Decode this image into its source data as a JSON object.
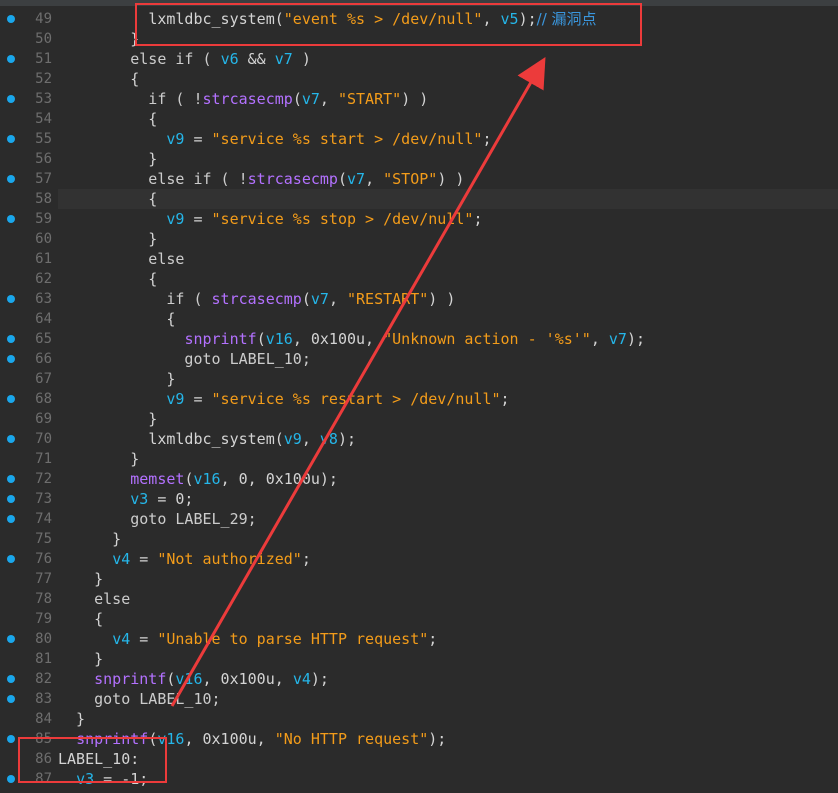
{
  "editor": {
    "lines": [
      {
        "n": "49",
        "bp": true,
        "tokens": [
          {
            "t": "          ",
            "c": "p"
          },
          {
            "t": "lxmldbc_system",
            "c": "id"
          },
          {
            "t": "(",
            "c": "p"
          },
          {
            "t": "\"event %s > /dev/null\"",
            "c": "str"
          },
          {
            "t": ", ",
            "c": "p"
          },
          {
            "t": "v5",
            "c": "var"
          },
          {
            "t": ");",
            "c": "p"
          },
          {
            "t": "// 漏洞点",
            "c": "cm"
          }
        ]
      },
      {
        "n": "50",
        "bp": false,
        "tokens": [
          {
            "t": "        }",
            "c": "p"
          }
        ]
      },
      {
        "n": "51",
        "bp": true,
        "tokens": [
          {
            "t": "        else if ( ",
            "c": "kw"
          },
          {
            "t": "v6",
            "c": "var"
          },
          {
            "t": " && ",
            "c": "p"
          },
          {
            "t": "v7",
            "c": "var"
          },
          {
            "t": " )",
            "c": "p"
          }
        ]
      },
      {
        "n": "52",
        "bp": false,
        "tokens": [
          {
            "t": "        {",
            "c": "p"
          }
        ]
      },
      {
        "n": "53",
        "bp": true,
        "tokens": [
          {
            "t": "          if ( !",
            "c": "kw"
          },
          {
            "t": "strcasecmp",
            "c": "fn"
          },
          {
            "t": "(",
            "c": "p"
          },
          {
            "t": "v7",
            "c": "var"
          },
          {
            "t": ", ",
            "c": "p"
          },
          {
            "t": "\"START\"",
            "c": "str"
          },
          {
            "t": ") )",
            "c": "p"
          }
        ]
      },
      {
        "n": "54",
        "bp": false,
        "tokens": [
          {
            "t": "          {",
            "c": "p"
          }
        ]
      },
      {
        "n": "55",
        "bp": true,
        "tokens": [
          {
            "t": "            ",
            "c": "p"
          },
          {
            "t": "v9",
            "c": "var"
          },
          {
            "t": " = ",
            "c": "p"
          },
          {
            "t": "\"service %s start > /dev/null\"",
            "c": "str"
          },
          {
            "t": ";",
            "c": "p"
          }
        ]
      },
      {
        "n": "56",
        "bp": false,
        "tokens": [
          {
            "t": "          }",
            "c": "p"
          }
        ]
      },
      {
        "n": "57",
        "bp": true,
        "tokens": [
          {
            "t": "          else if ( !",
            "c": "kw"
          },
          {
            "t": "strcasecmp",
            "c": "fn"
          },
          {
            "t": "(",
            "c": "p"
          },
          {
            "t": "v7",
            "c": "var"
          },
          {
            "t": ", ",
            "c": "p"
          },
          {
            "t": "\"STOP\"",
            "c": "str"
          },
          {
            "t": ") )",
            "c": "p"
          }
        ]
      },
      {
        "n": "58",
        "bp": false,
        "hl": true,
        "tokens": [
          {
            "t": "          {",
            "c": "p"
          }
        ]
      },
      {
        "n": "59",
        "bp": true,
        "tokens": [
          {
            "t": "            ",
            "c": "p"
          },
          {
            "t": "v9",
            "c": "var"
          },
          {
            "t": " = ",
            "c": "p"
          },
          {
            "t": "\"service %s stop > /dev/null\"",
            "c": "str"
          },
          {
            "t": ";",
            "c": "p"
          }
        ]
      },
      {
        "n": "60",
        "bp": false,
        "tokens": [
          {
            "t": "          }",
            "c": "p"
          }
        ]
      },
      {
        "n": "61",
        "bp": false,
        "tokens": [
          {
            "t": "          else",
            "c": "kw"
          }
        ]
      },
      {
        "n": "62",
        "bp": false,
        "tokens": [
          {
            "t": "          {",
            "c": "p"
          }
        ]
      },
      {
        "n": "63",
        "bp": true,
        "tokens": [
          {
            "t": "            if ( ",
            "c": "kw"
          },
          {
            "t": "strcasecmp",
            "c": "fn"
          },
          {
            "t": "(",
            "c": "p"
          },
          {
            "t": "v7",
            "c": "var"
          },
          {
            "t": ", ",
            "c": "p"
          },
          {
            "t": "\"RESTART\"",
            "c": "str"
          },
          {
            "t": ") )",
            "c": "p"
          }
        ]
      },
      {
        "n": "64",
        "bp": false,
        "tokens": [
          {
            "t": "            {",
            "c": "p"
          }
        ]
      },
      {
        "n": "65",
        "bp": true,
        "tokens": [
          {
            "t": "              ",
            "c": "p"
          },
          {
            "t": "snprintf",
            "c": "fn"
          },
          {
            "t": "(",
            "c": "p"
          },
          {
            "t": "v16",
            "c": "var"
          },
          {
            "t": ", 0x100u, ",
            "c": "p"
          },
          {
            "t": "\"Unknown action - '%s'\"",
            "c": "str"
          },
          {
            "t": ", ",
            "c": "p"
          },
          {
            "t": "v7",
            "c": "var"
          },
          {
            "t": ");",
            "c": "p"
          }
        ]
      },
      {
        "n": "66",
        "bp": true,
        "tokens": [
          {
            "t": "              goto LABEL_10;",
            "c": "kw"
          }
        ]
      },
      {
        "n": "67",
        "bp": false,
        "tokens": [
          {
            "t": "            }",
            "c": "p"
          }
        ]
      },
      {
        "n": "68",
        "bp": true,
        "tokens": [
          {
            "t": "            ",
            "c": "p"
          },
          {
            "t": "v9",
            "c": "var"
          },
          {
            "t": " = ",
            "c": "p"
          },
          {
            "t": "\"service %s restart > /dev/null\"",
            "c": "str"
          },
          {
            "t": ";",
            "c": "p"
          }
        ]
      },
      {
        "n": "69",
        "bp": false,
        "tokens": [
          {
            "t": "          }",
            "c": "p"
          }
        ]
      },
      {
        "n": "70",
        "bp": true,
        "tokens": [
          {
            "t": "          ",
            "c": "p"
          },
          {
            "t": "lxmldbc_system",
            "c": "id"
          },
          {
            "t": "(",
            "c": "p"
          },
          {
            "t": "v9",
            "c": "var"
          },
          {
            "t": ", ",
            "c": "p"
          },
          {
            "t": "v8",
            "c": "var"
          },
          {
            "t": ");",
            "c": "p"
          }
        ]
      },
      {
        "n": "71",
        "bp": false,
        "tokens": [
          {
            "t": "        }",
            "c": "p"
          }
        ]
      },
      {
        "n": "72",
        "bp": true,
        "tokens": [
          {
            "t": "        ",
            "c": "p"
          },
          {
            "t": "memset",
            "c": "fn"
          },
          {
            "t": "(",
            "c": "p"
          },
          {
            "t": "v16",
            "c": "var"
          },
          {
            "t": ", 0, 0x100u);",
            "c": "p"
          }
        ]
      },
      {
        "n": "73",
        "bp": true,
        "tokens": [
          {
            "t": "        ",
            "c": "p"
          },
          {
            "t": "v3",
            "c": "var"
          },
          {
            "t": " = 0;",
            "c": "p"
          }
        ]
      },
      {
        "n": "74",
        "bp": true,
        "tokens": [
          {
            "t": "        goto LABEL_29;",
            "c": "kw"
          }
        ]
      },
      {
        "n": "75",
        "bp": false,
        "tokens": [
          {
            "t": "      }",
            "c": "p"
          }
        ]
      },
      {
        "n": "76",
        "bp": true,
        "tokens": [
          {
            "t": "      ",
            "c": "p"
          },
          {
            "t": "v4",
            "c": "var"
          },
          {
            "t": " = ",
            "c": "p"
          },
          {
            "t": "\"Not authorized\"",
            "c": "str"
          },
          {
            "t": ";",
            "c": "p"
          }
        ]
      },
      {
        "n": "77",
        "bp": false,
        "tokens": [
          {
            "t": "    }",
            "c": "p"
          }
        ]
      },
      {
        "n": "78",
        "bp": false,
        "tokens": [
          {
            "t": "    else",
            "c": "kw"
          }
        ]
      },
      {
        "n": "79",
        "bp": false,
        "tokens": [
          {
            "t": "    {",
            "c": "p"
          }
        ]
      },
      {
        "n": "80",
        "bp": true,
        "tokens": [
          {
            "t": "      ",
            "c": "p"
          },
          {
            "t": "v4",
            "c": "var"
          },
          {
            "t": " = ",
            "c": "p"
          },
          {
            "t": "\"Unable to parse HTTP request\"",
            "c": "str"
          },
          {
            "t": ";",
            "c": "p"
          }
        ]
      },
      {
        "n": "81",
        "bp": false,
        "tokens": [
          {
            "t": "    }",
            "c": "p"
          }
        ]
      },
      {
        "n": "82",
        "bp": true,
        "tokens": [
          {
            "t": "    ",
            "c": "p"
          },
          {
            "t": "snprintf",
            "c": "fn"
          },
          {
            "t": "(",
            "c": "p"
          },
          {
            "t": "v16",
            "c": "var"
          },
          {
            "t": ", 0x100u, ",
            "c": "p"
          },
          {
            "t": "v4",
            "c": "var"
          },
          {
            "t": ");",
            "c": "p"
          }
        ]
      },
      {
        "n": "83",
        "bp": true,
        "tokens": [
          {
            "t": "    goto LABEL_10;",
            "c": "kw"
          }
        ]
      },
      {
        "n": "84",
        "bp": false,
        "tokens": [
          {
            "t": "  }",
            "c": "p"
          }
        ]
      },
      {
        "n": "85",
        "bp": true,
        "tokens": [
          {
            "t": "  ",
            "c": "p"
          },
          {
            "t": "snprintf",
            "c": "fn"
          },
          {
            "t": "(",
            "c": "p"
          },
          {
            "t": "v16",
            "c": "var"
          },
          {
            "t": ", 0x100u, ",
            "c": "p"
          },
          {
            "t": "\"No HTTP request\"",
            "c": "str"
          },
          {
            "t": ");",
            "c": "p"
          }
        ]
      },
      {
        "n": "86",
        "bp": false,
        "tokens": [
          {
            "t": "LABEL_10:",
            "c": "id"
          }
        ]
      },
      {
        "n": "87",
        "bp": true,
        "tokens": [
          {
            "t": "  ",
            "c": "p"
          },
          {
            "t": "v3",
            "c": "var"
          },
          {
            "t": " = -1;",
            "c": "p"
          }
        ]
      }
    ]
  },
  "annotation_color": "#ec3b3b"
}
